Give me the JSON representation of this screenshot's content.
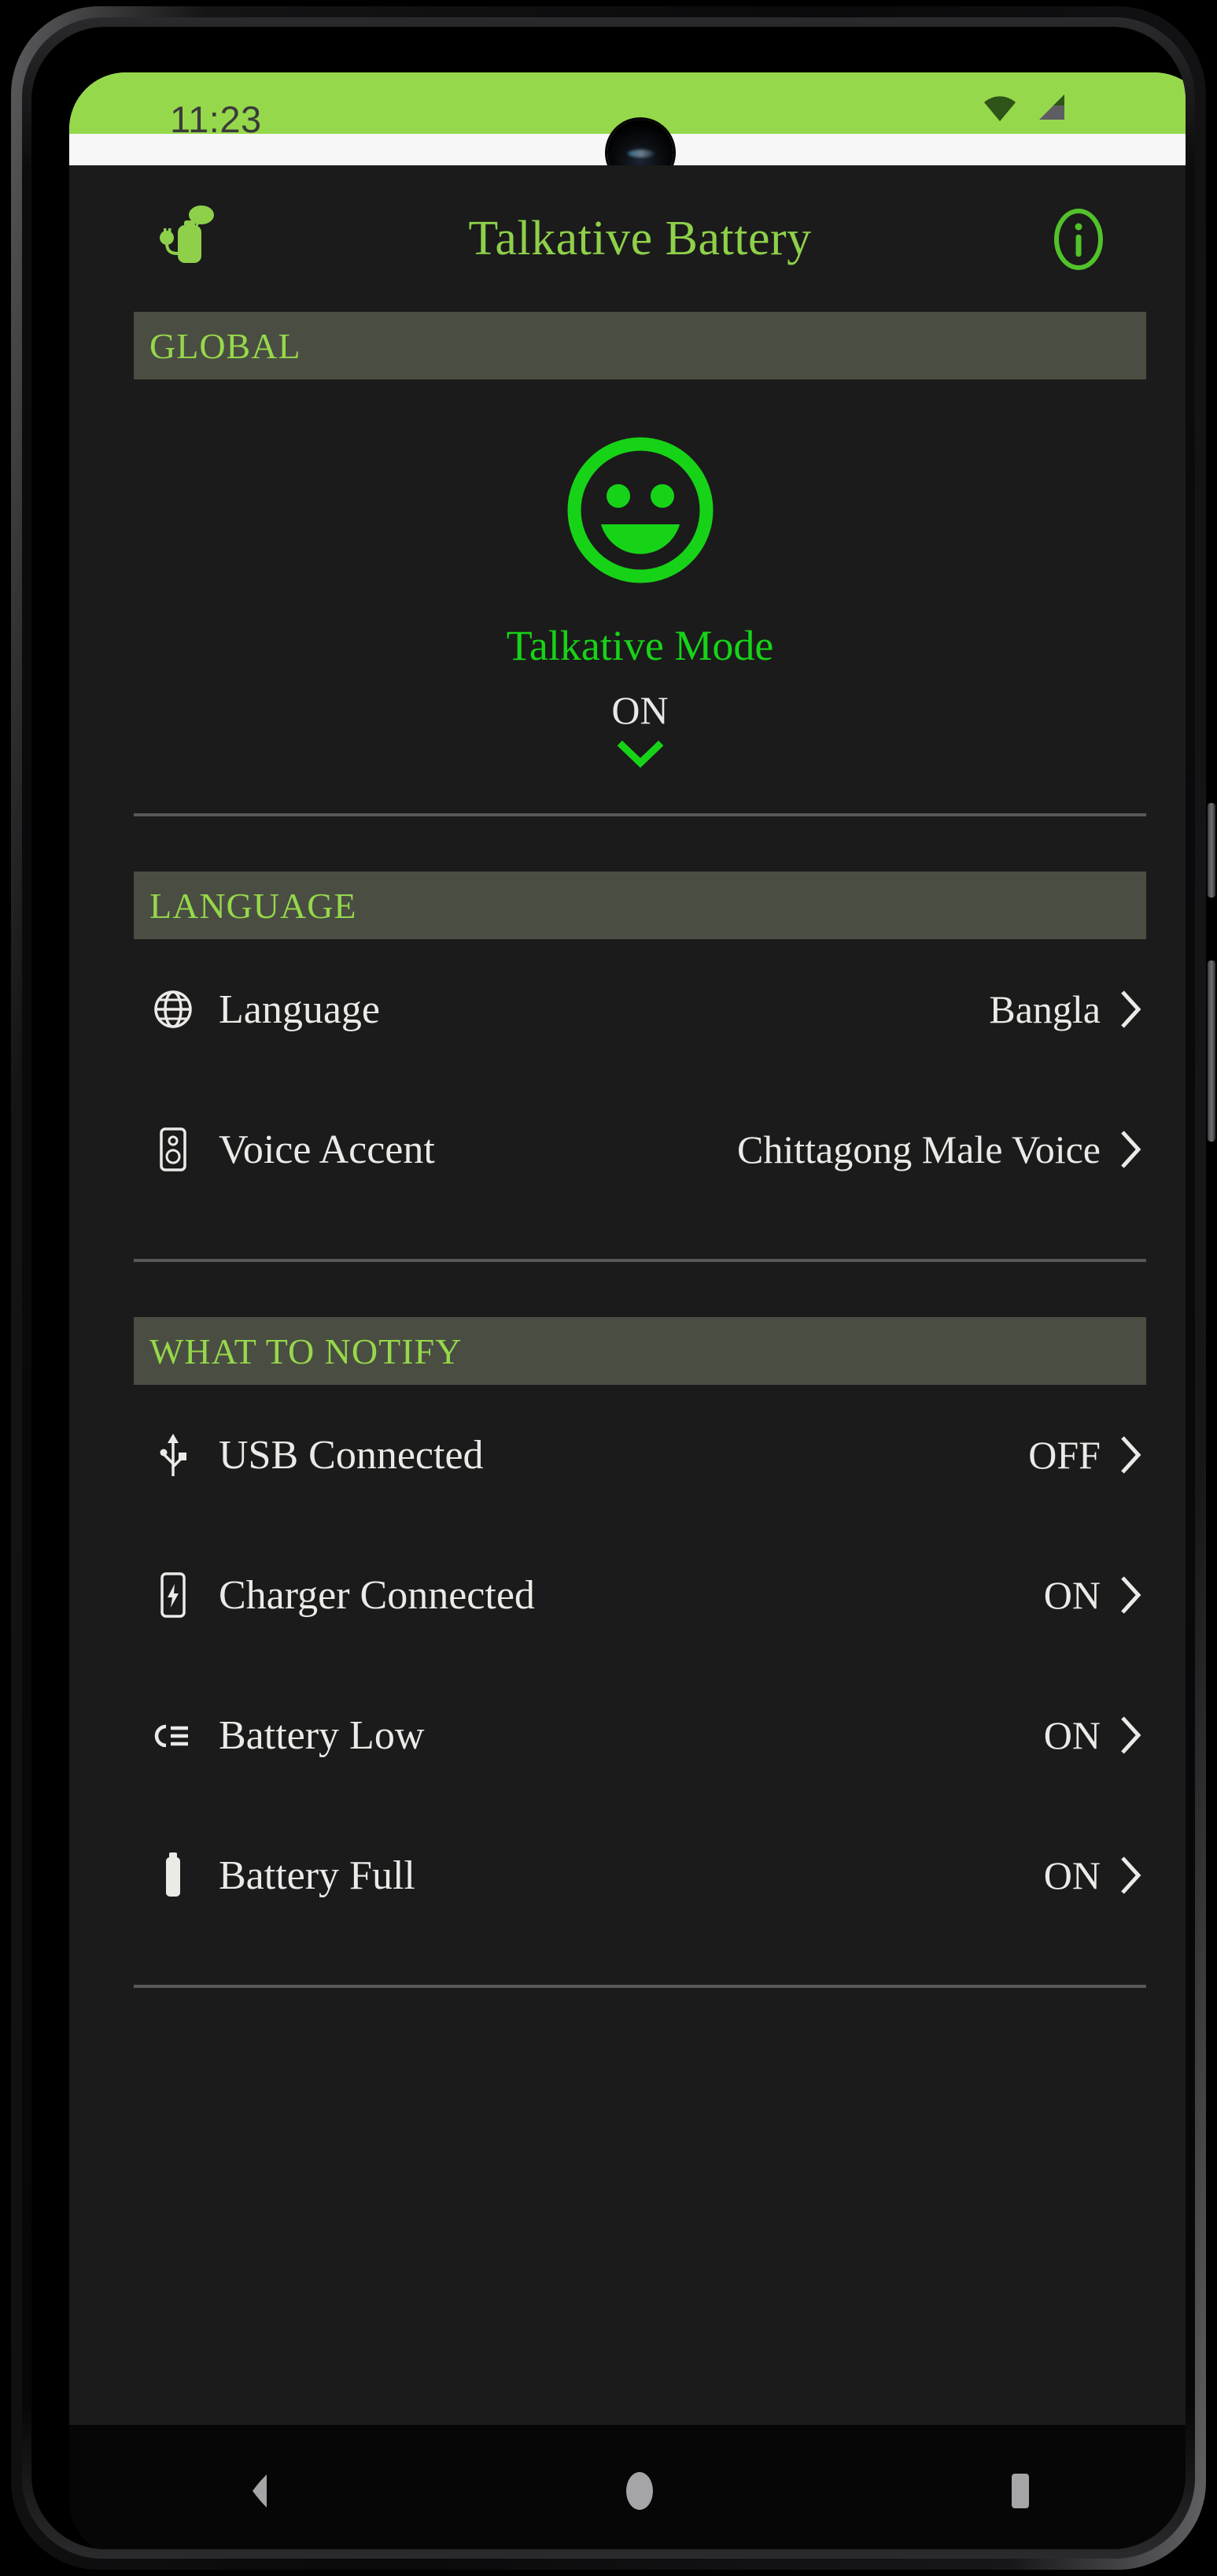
{
  "status_bar": {
    "clock": "11:23",
    "wifi_icon": "wifi-icon",
    "signal_icon": "cellular-signal-icon",
    "band_color": "#96d84b"
  },
  "app_bar": {
    "logo_icon": "talkative-battery-logo-icon",
    "title": "Talkative Battery",
    "info_icon": "info-icon",
    "title_color": "#8ed04a"
  },
  "sections": [
    {
      "header": "GLOBAL",
      "type": "global",
      "face_icon": "smiley-face-icon",
      "face_color": "#17d317",
      "mode_label": "Talkative Mode",
      "mode_value": "ON",
      "chevron_icon": "chevron-down-icon"
    },
    {
      "header": "LANGUAGE",
      "type": "rows",
      "rows": [
        {
          "icon": "globe-icon",
          "label": "Language",
          "value": "Bangla",
          "chevron": "chevron-right-icon"
        },
        {
          "icon": "speaker-icon",
          "label": "Voice Accent",
          "value": "Chittagong Male Voice",
          "chevron": "chevron-right-icon"
        }
      ]
    },
    {
      "header": "WHAT TO NOTIFY",
      "type": "rows",
      "rows": [
        {
          "icon": "usb-icon",
          "label": "USB Connected",
          "value": "OFF",
          "chevron": "chevron-right-icon"
        },
        {
          "icon": "charging-phone-icon",
          "label": "Charger Connected",
          "value": "ON",
          "chevron": "chevron-right-icon"
        },
        {
          "icon": "battery-low-icon",
          "label": "Battery Low",
          "value": "ON",
          "chevron": "chevron-right-icon"
        },
        {
          "icon": "battery-full-icon",
          "label": "Battery Full",
          "value": "ON",
          "chevron": "chevron-right-icon"
        }
      ]
    }
  ],
  "nav_bar": {
    "back_label": "back-icon",
    "home_label": "home-icon",
    "recents_label": "recents-icon"
  },
  "theme": {
    "accent_green": "#96d84b",
    "bright_green": "#17d317",
    "background": "#1b1b1b",
    "section_header_bg": "#4a4e42",
    "text": "#eceae6"
  }
}
